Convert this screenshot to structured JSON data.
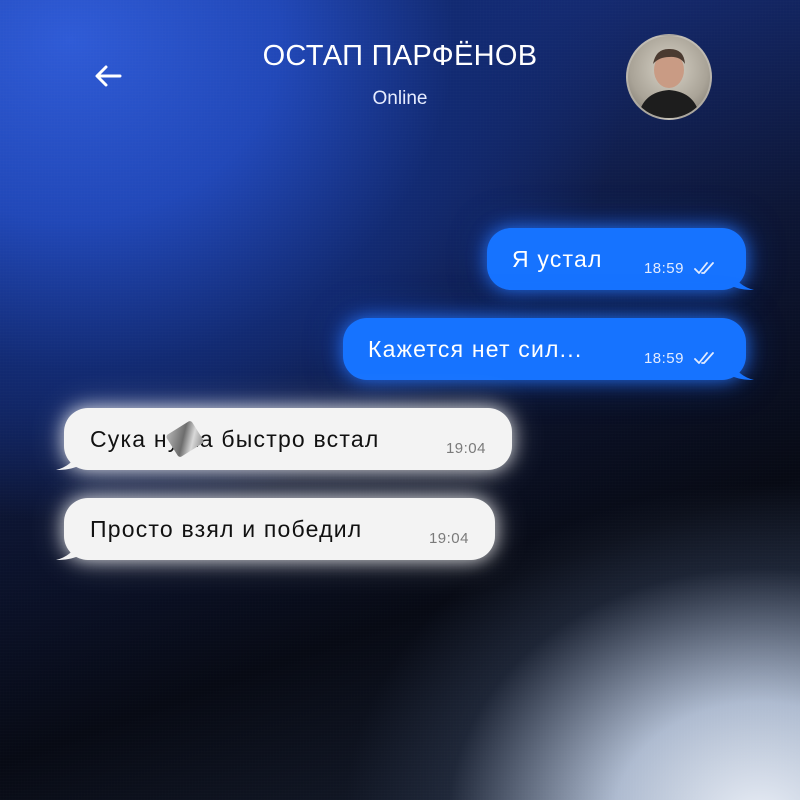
{
  "header": {
    "back_icon": "arrow-left-icon",
    "contact_name": "ОСТАП ПАРФЁНОВ",
    "status": "Online",
    "avatar_icon": "contact-avatar"
  },
  "messages": [
    {
      "direction": "outgoing",
      "text": "Я устал",
      "time": "18:59",
      "read_icon": "double-check-icon"
    },
    {
      "direction": "outgoing",
      "text": "Кажется нет сил...",
      "time": "18:59",
      "read_icon": "double-check-icon"
    },
    {
      "direction": "incoming",
      "text": "Сука ну ка быстро встал",
      "time": "19:04",
      "sticker_icon": "censor-sticker-icon"
    },
    {
      "direction": "incoming",
      "text": "Просто взял и победил",
      "time": "19:04"
    }
  ],
  "colors": {
    "outgoing_bubble": "#1673ff",
    "incoming_bubble": "#f3f3f3",
    "background_blue": "#2148b8",
    "background_dark": "#070a14"
  }
}
